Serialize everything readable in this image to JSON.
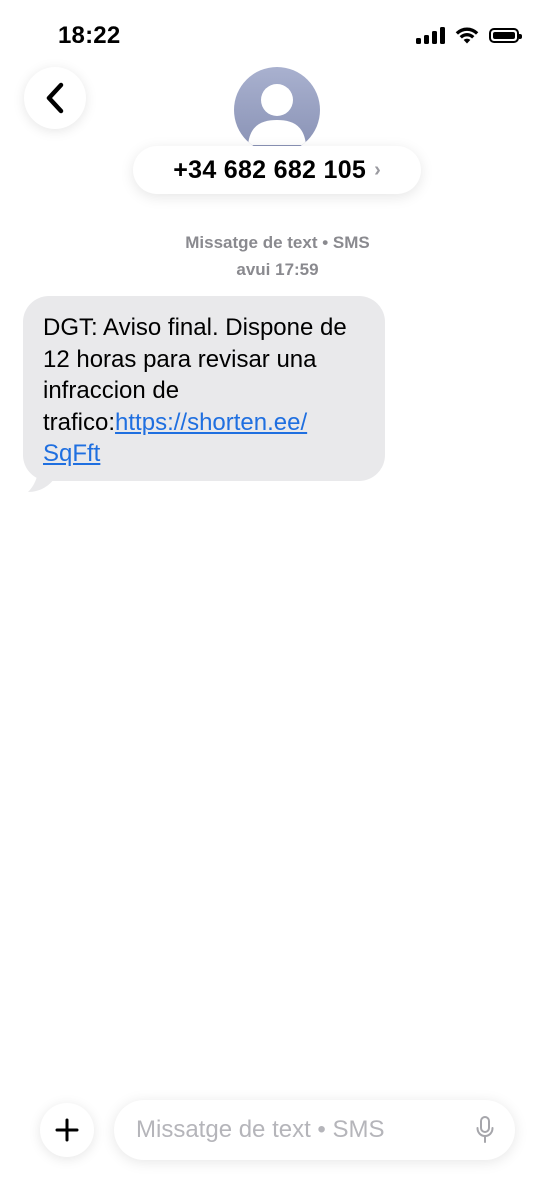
{
  "status_bar": {
    "time": "18:22",
    "icons": [
      "signal-icon",
      "wifi-icon",
      "battery-icon"
    ],
    "battery_level": 1.0
  },
  "header": {
    "back_icon": "chevron-left-icon",
    "avatar_icon": "person-silhouette-icon",
    "contact_number": "+34 682 682 105",
    "chevron": "›"
  },
  "conversation": {
    "service_label": "Missatge de text • SMS",
    "timestamp": "avui 17:59",
    "messages": [
      {
        "direction": "incoming",
        "text_before_link": "DGT: Aviso final. Dispone de 12 horas para revisar una infraccion de trafico:",
        "link_text": "https://shorten.ee/SqFft",
        "link_line1": "https://shorten.ee/",
        "link_line2": "SqFft"
      }
    ]
  },
  "composer": {
    "add_icon": "plus-icon",
    "placeholder": "Missatge de text • SMS",
    "value": "",
    "mic_icon": "microphone-icon"
  },
  "colors": {
    "incoming_bubble": "#e9e9eb",
    "link": "#1f6fe0",
    "meta_text": "#8a8a8f",
    "avatar_bg": "#9aa2c3"
  }
}
